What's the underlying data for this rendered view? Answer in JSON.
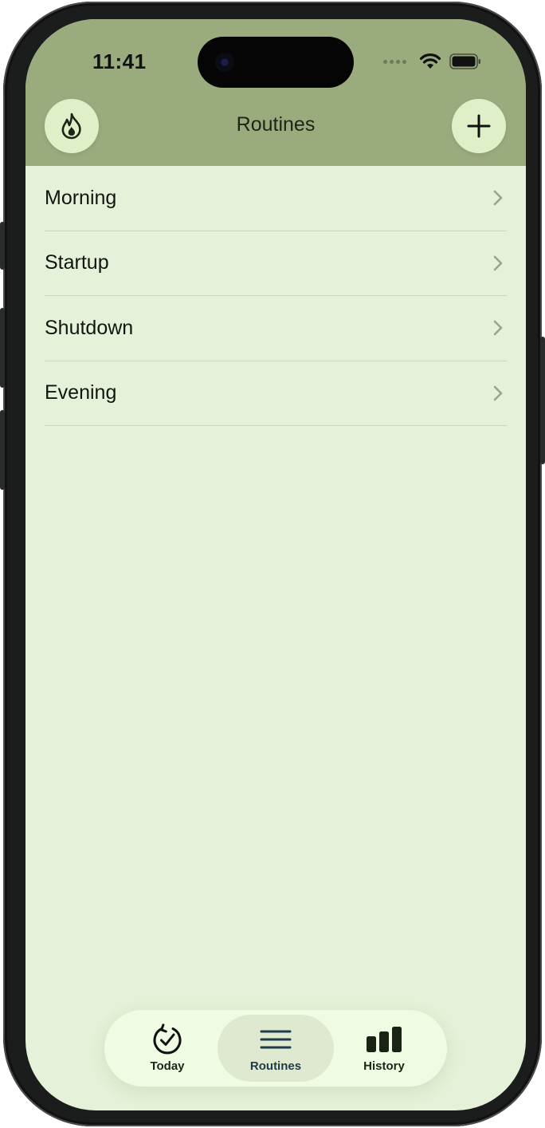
{
  "status_bar": {
    "time": "11:41"
  },
  "header": {
    "title": "Routines",
    "left_icon": "flame-icon",
    "right_icon": "plus-icon"
  },
  "routines": [
    {
      "label": "Morning"
    },
    {
      "label": "Startup"
    },
    {
      "label": "Shutdown"
    },
    {
      "label": "Evening"
    }
  ],
  "tabbar": {
    "tabs": [
      {
        "label": "Today",
        "icon": "check-circle-refresh-icon"
      },
      {
        "label": "Routines",
        "icon": "list-lines-icon",
        "active": true
      },
      {
        "label": "History",
        "icon": "bar-chart-icon"
      }
    ]
  },
  "colors": {
    "header_bg": "#9aab7e",
    "screen_bg": "#e5f1d8",
    "button_bg": "#dff0c8",
    "tabbar_bg": "#f0fbe4",
    "active_tab_bg": "#dfe9d0"
  }
}
